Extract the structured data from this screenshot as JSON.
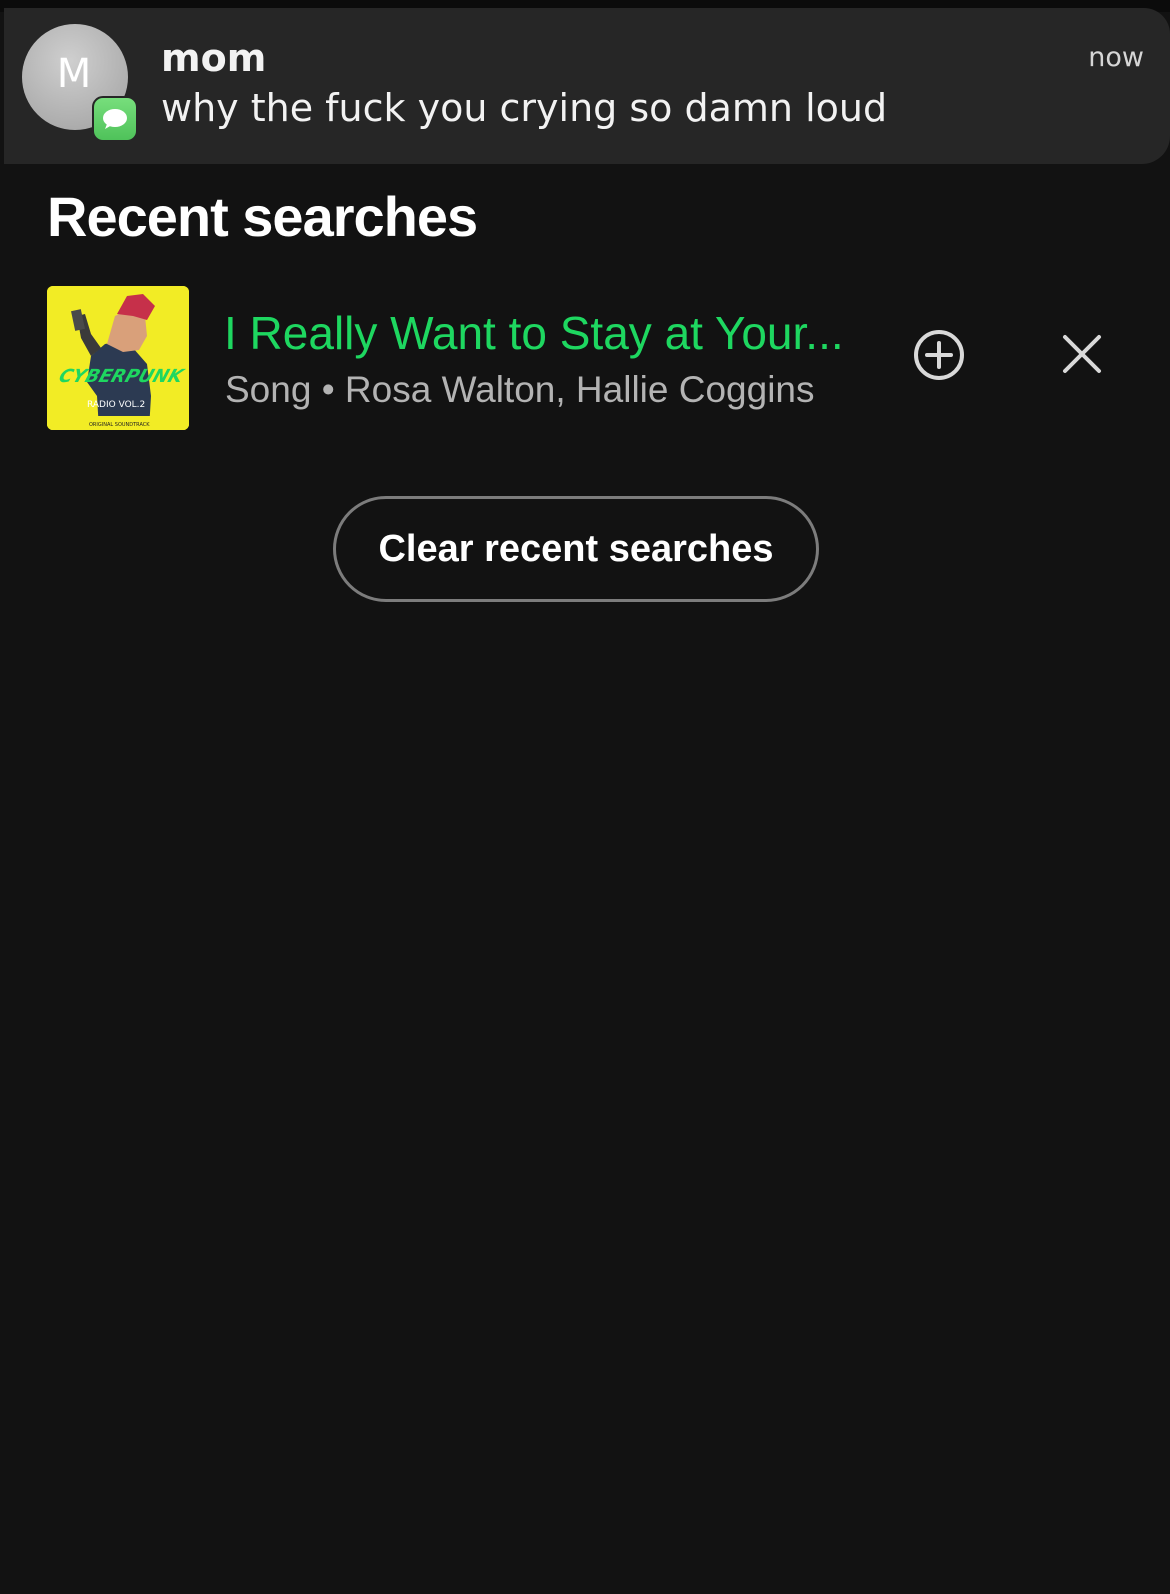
{
  "notification": {
    "avatar_letter": "M",
    "app_icon": "messages-bubble-icon",
    "sender": "mom",
    "message": "why the fuck you crying so damn loud",
    "time": "now"
  },
  "recent_searches": {
    "title": "Recent searches",
    "items": [
      {
        "title": "I Really Want to Stay at Your...",
        "subtitle": "Song • Rosa Walton, Hallie Coggins",
        "cover_text": {
          "logo": "CYBERPUNK",
          "radio": "RADIO VOL.2",
          "footer": "ORIGINAL SOUNDTRACK"
        }
      }
    ],
    "clear_label": "Clear recent searches"
  },
  "colors": {
    "background": "#121212",
    "accent_green": "#1ed760",
    "notification_bg": "#262626",
    "secondary_text": "#b3b3b3",
    "cover_yellow": "#f2ec25"
  },
  "icons": {
    "add": "plus-circle-icon",
    "remove": "close-icon"
  }
}
